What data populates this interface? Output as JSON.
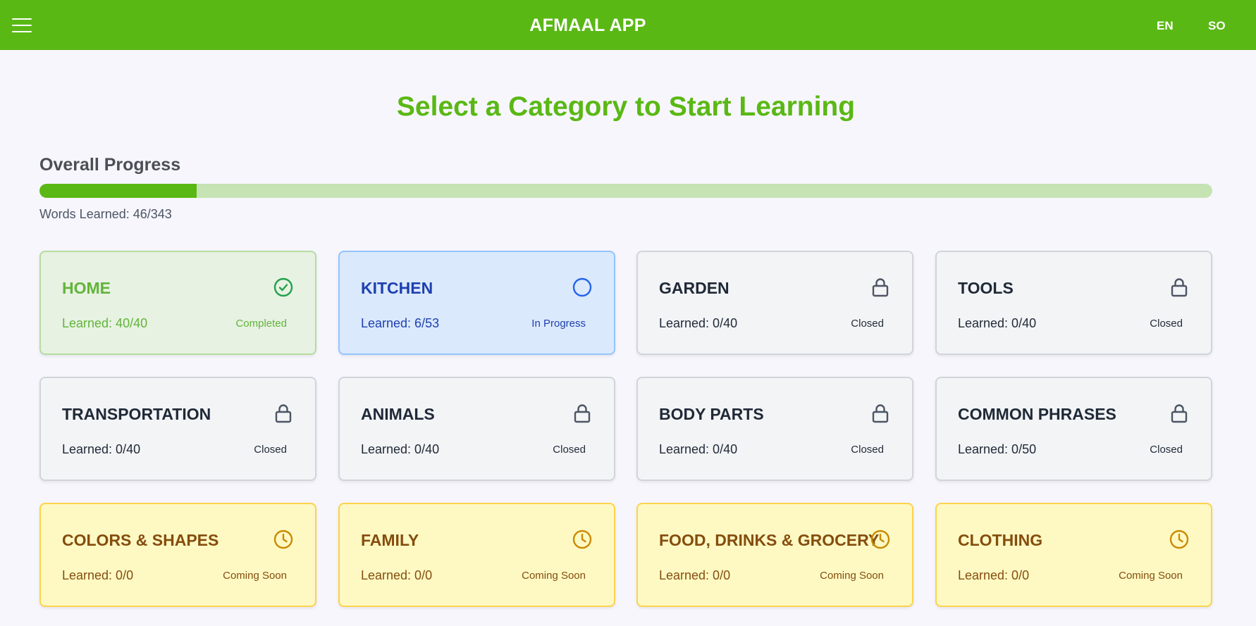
{
  "header": {
    "title": "AFMAAL APP",
    "lang_en": "EN",
    "lang_so": "SO"
  },
  "main": {
    "headline": "Select a Category to Start Learning",
    "progress": {
      "label": "Overall Progress",
      "words_learned": "Words Learned: 46/343",
      "fraction": 0.134
    }
  },
  "categories": [
    {
      "name": "HOME",
      "count": "Learned: 40/40",
      "status": "Completed",
      "state": "completed",
      "icon": "check-circle-icon"
    },
    {
      "name": "KITCHEN",
      "count": "Learned: 6/53",
      "status": "In Progress",
      "state": "progress",
      "icon": "circle-icon"
    },
    {
      "name": "GARDEN",
      "count": "Learned: 0/40",
      "status": "Closed",
      "state": "closed",
      "icon": "lock-icon"
    },
    {
      "name": "TOOLS",
      "count": "Learned: 0/40",
      "status": "Closed",
      "state": "closed",
      "icon": "lock-icon"
    },
    {
      "name": "TRANSPORTATION",
      "count": "Learned: 0/40",
      "status": "Closed",
      "state": "closed",
      "icon": "lock-icon"
    },
    {
      "name": "ANIMALS",
      "count": "Learned: 0/40",
      "status": "Closed",
      "state": "closed",
      "icon": "lock-icon"
    },
    {
      "name": "BODY PARTS",
      "count": "Learned: 0/40",
      "status": "Closed",
      "state": "closed",
      "icon": "lock-icon"
    },
    {
      "name": "COMMON PHRASES",
      "count": "Learned: 0/50",
      "status": "Closed",
      "state": "closed",
      "icon": "lock-icon"
    },
    {
      "name": "COLORS & SHAPES",
      "count": "Learned: 0/0",
      "status": "Coming Soon",
      "state": "soon",
      "icon": "clock-icon"
    },
    {
      "name": "FAMILY",
      "count": "Learned: 0/0",
      "status": "Coming Soon",
      "state": "soon",
      "icon": "clock-icon"
    },
    {
      "name": "FOOD, DRINKS & GROCERY",
      "count": "Learned: 0/0",
      "status": "Coming Soon",
      "state": "soon",
      "icon": "clock-icon"
    },
    {
      "name": "CLOTHING",
      "count": "Learned: 0/0",
      "status": "Coming Soon",
      "state": "soon",
      "icon": "clock-icon"
    }
  ],
  "colors": {
    "brand": "#5ab814",
    "completed": "#22a04b",
    "progress": "#2563eb",
    "closed": "#4b5563",
    "soon": "#ca8a04"
  }
}
